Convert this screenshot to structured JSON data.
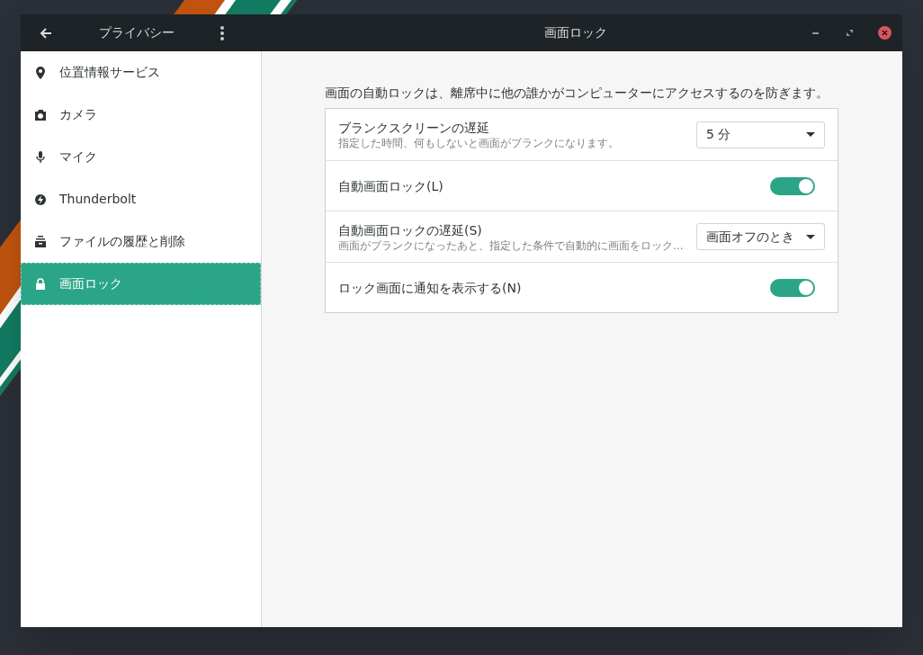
{
  "window": {
    "sidebar_title": "プライバシー",
    "title": "画面ロック"
  },
  "sidebar": {
    "items": [
      {
        "label": "位置情報サービス",
        "selected": false
      },
      {
        "label": "カメラ",
        "selected": false
      },
      {
        "label": "マイク",
        "selected": false
      },
      {
        "label": "Thunderbolt",
        "selected": false
      },
      {
        "label": "ファイルの履歴と削除",
        "selected": false
      },
      {
        "label": "画面ロック",
        "selected": true
      }
    ]
  },
  "description": "画面の自動ロックは、離席中に他の誰かがコンピューターにアクセスするのを防ぎます。",
  "settings": [
    {
      "kind": "dropdown",
      "label": "ブランクスクリーンの遅延",
      "subtitle": "指定した時間、何もしないと画面がブランクになります。",
      "value": "5 分"
    },
    {
      "kind": "switch",
      "label": "自動画面ロック(L)",
      "on": true
    },
    {
      "kind": "dropdown",
      "label": "自動画面ロックの遅延(S)",
      "subtitle": "画面がブランクになったあと、指定した条件で自動的に画面をロック…",
      "value": "画面オフのとき"
    },
    {
      "kind": "switch",
      "label": "ロック画面に通知を表示する(N)",
      "on": true
    }
  ]
}
